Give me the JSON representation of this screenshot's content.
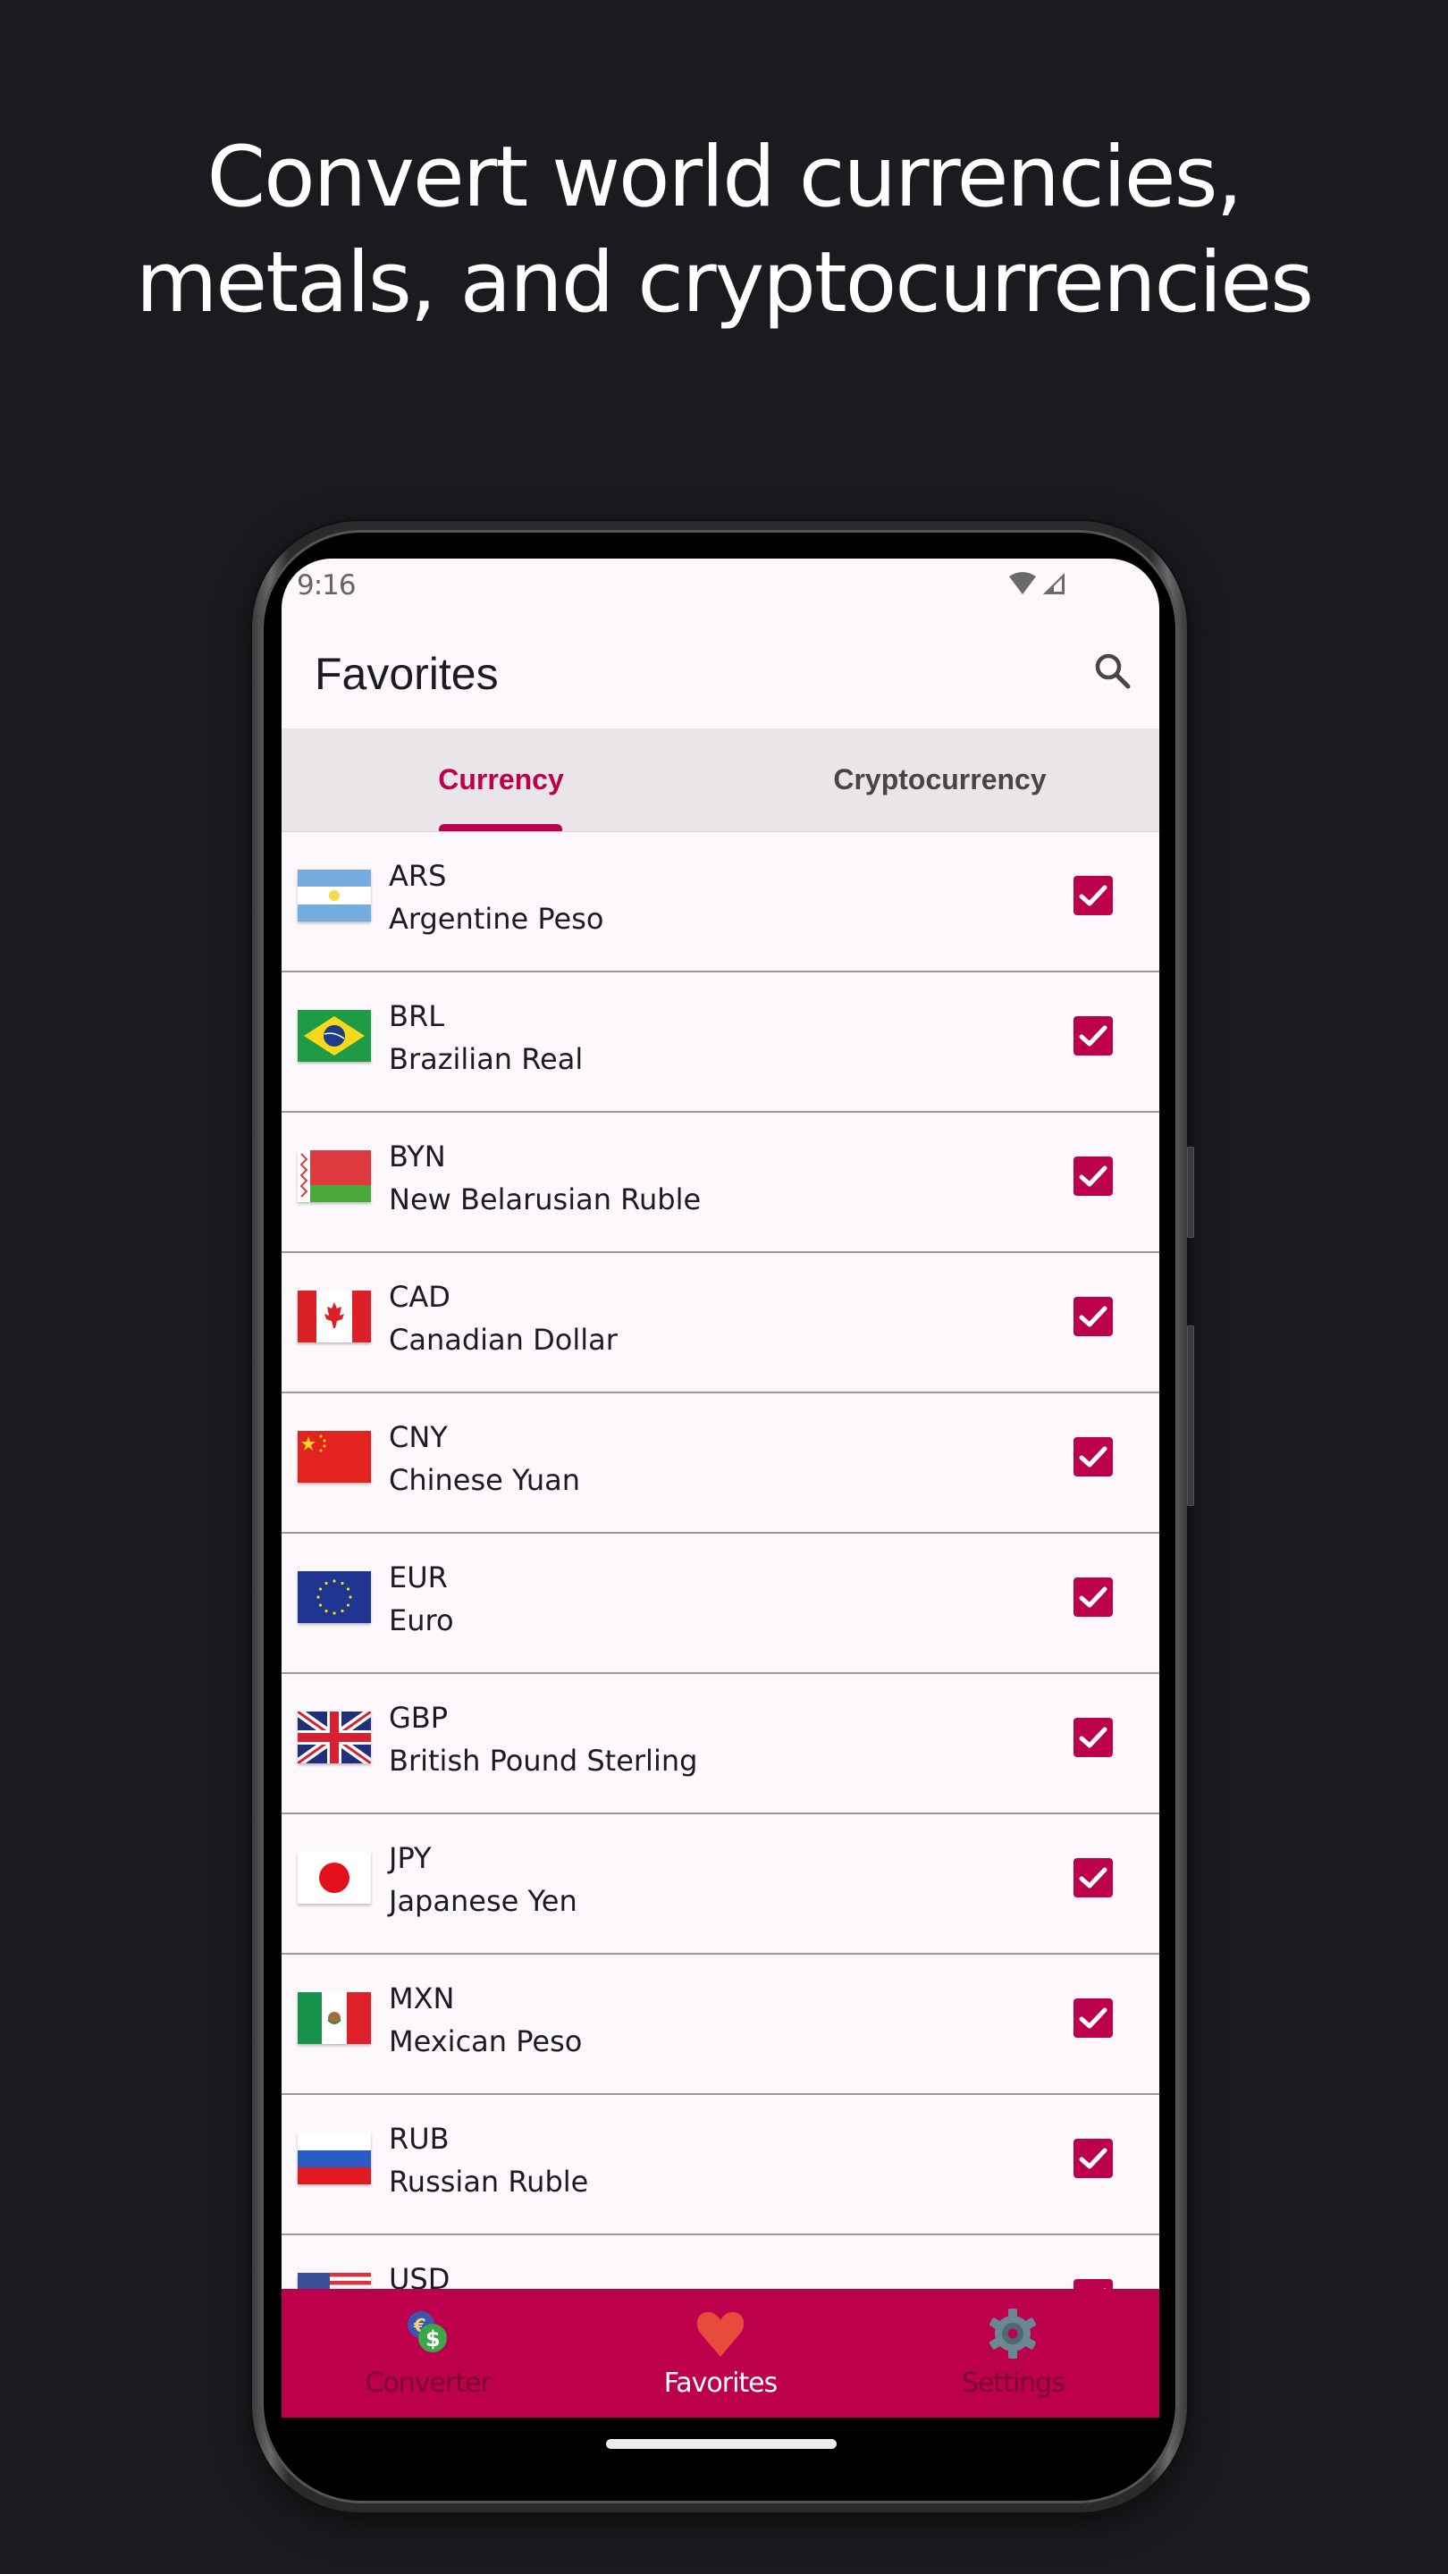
{
  "headline": {
    "line1": "Convert world currencies,",
    "line2": "metals, and cryptocurrencies"
  },
  "status_bar": {
    "time": "9:16",
    "icons": [
      "wifi-icon",
      "cellular-signal-icon"
    ]
  },
  "app_bar": {
    "title": "Favorites",
    "search_icon": "search-icon"
  },
  "tabs": [
    {
      "label": "Currency",
      "selected": true
    },
    {
      "label": "Cryptocurrency",
      "selected": false
    }
  ],
  "currencies": [
    {
      "code": "ARS",
      "name": "Argentine Peso",
      "flag": "argentina-flag",
      "checked": true
    },
    {
      "code": "BRL",
      "name": "Brazilian Real",
      "flag": "brazil-flag",
      "checked": true
    },
    {
      "code": "BYN",
      "name": "New Belarusian Ruble",
      "flag": "belarus-flag",
      "checked": true
    },
    {
      "code": "CAD",
      "name": "Canadian Dollar",
      "flag": "canada-flag",
      "checked": true
    },
    {
      "code": "CNY",
      "name": "Chinese Yuan",
      "flag": "china-flag",
      "checked": true
    },
    {
      "code": "EUR",
      "name": "Euro",
      "flag": "eu-flag",
      "checked": true
    },
    {
      "code": "GBP",
      "name": "British Pound Sterling",
      "flag": "uk-flag",
      "checked": true
    },
    {
      "code": "JPY",
      "name": "Japanese Yen",
      "flag": "japan-flag",
      "checked": true
    },
    {
      "code": "MXN",
      "name": "Mexican Peso",
      "flag": "mexico-flag",
      "checked": true
    },
    {
      "code": "RUB",
      "name": "Russian Ruble",
      "flag": "russia-flag",
      "checked": true
    },
    {
      "code": "USD",
      "name": "",
      "flag": "usa-flag",
      "checked": true
    }
  ],
  "bottom_nav": [
    {
      "label": "Converter",
      "icon": "currency-exchange-icon",
      "active": false
    },
    {
      "label": "Favorites",
      "icon": "heart-icon",
      "active": true
    },
    {
      "label": "Settings",
      "icon": "gear-icon",
      "active": false
    }
  ],
  "colors": {
    "accent": "#bd004b",
    "background": "#1b1b1f",
    "screen": "#fcf8fc",
    "tab_bar": "#e9e5e9"
  }
}
